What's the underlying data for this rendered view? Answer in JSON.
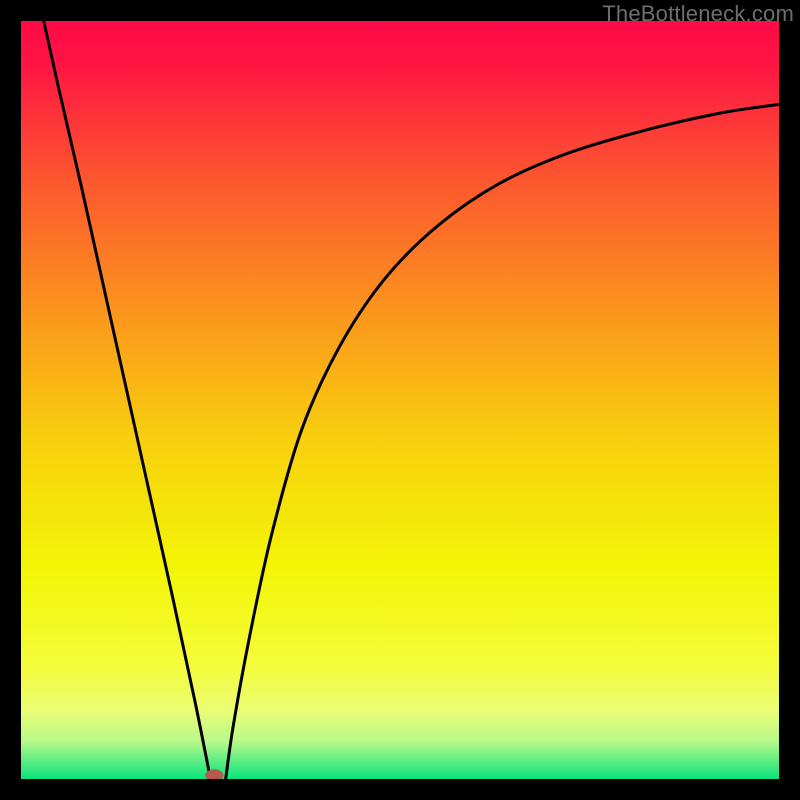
{
  "watermark": "TheBottleneck.com",
  "chart_data": {
    "type": "line",
    "title": "",
    "xlabel": "",
    "ylabel": "",
    "xlim": [
      0,
      100
    ],
    "ylim": [
      0,
      100
    ],
    "grid": false,
    "legend": false,
    "background": {
      "type": "vertical-gradient",
      "stops": [
        {
          "pos": 0,
          "color": "#ff0b47"
        },
        {
          "pos": 5,
          "color": "#ff1244"
        },
        {
          "pos": 20,
          "color": "#fc5330"
        },
        {
          "pos": 40,
          "color": "#fb9b1b"
        },
        {
          "pos": 55,
          "color": "#f8cf0e"
        },
        {
          "pos": 72,
          "color": "#f3f506"
        },
        {
          "pos": 85,
          "color": "#f4fc3a"
        },
        {
          "pos": 91,
          "color": "#eafd75"
        },
        {
          "pos": 95,
          "color": "#b9f989"
        },
        {
          "pos": 98,
          "color": "#4fec82"
        },
        {
          "pos": 100,
          "color": "#09e47c"
        }
      ]
    },
    "series": [
      {
        "name": "left-branch",
        "x": [
          3.0,
          5.0,
          8.0,
          12.0,
          16.0,
          20.0,
          23.0,
          25.0
        ],
        "y": [
          100.0,
          91.0,
          78.0,
          60.0,
          42.0,
          24.0,
          10.0,
          0.0
        ]
      },
      {
        "name": "right-branch",
        "x": [
          27.0,
          28.0,
          30.0,
          33.0,
          37.0,
          42.0,
          48.0,
          55.0,
          63.0,
          72.0,
          82.0,
          92.0,
          100.0
        ],
        "y": [
          0.0,
          7.0,
          18.0,
          32.0,
          46.0,
          57.0,
          66.0,
          73.0,
          78.5,
          82.5,
          85.5,
          87.8,
          89.0
        ]
      }
    ],
    "marker": {
      "name": "minimum-marker",
      "x": 25.5,
      "y": 0.5,
      "color": "#b45a4f",
      "rx": 9,
      "ry": 6
    }
  }
}
